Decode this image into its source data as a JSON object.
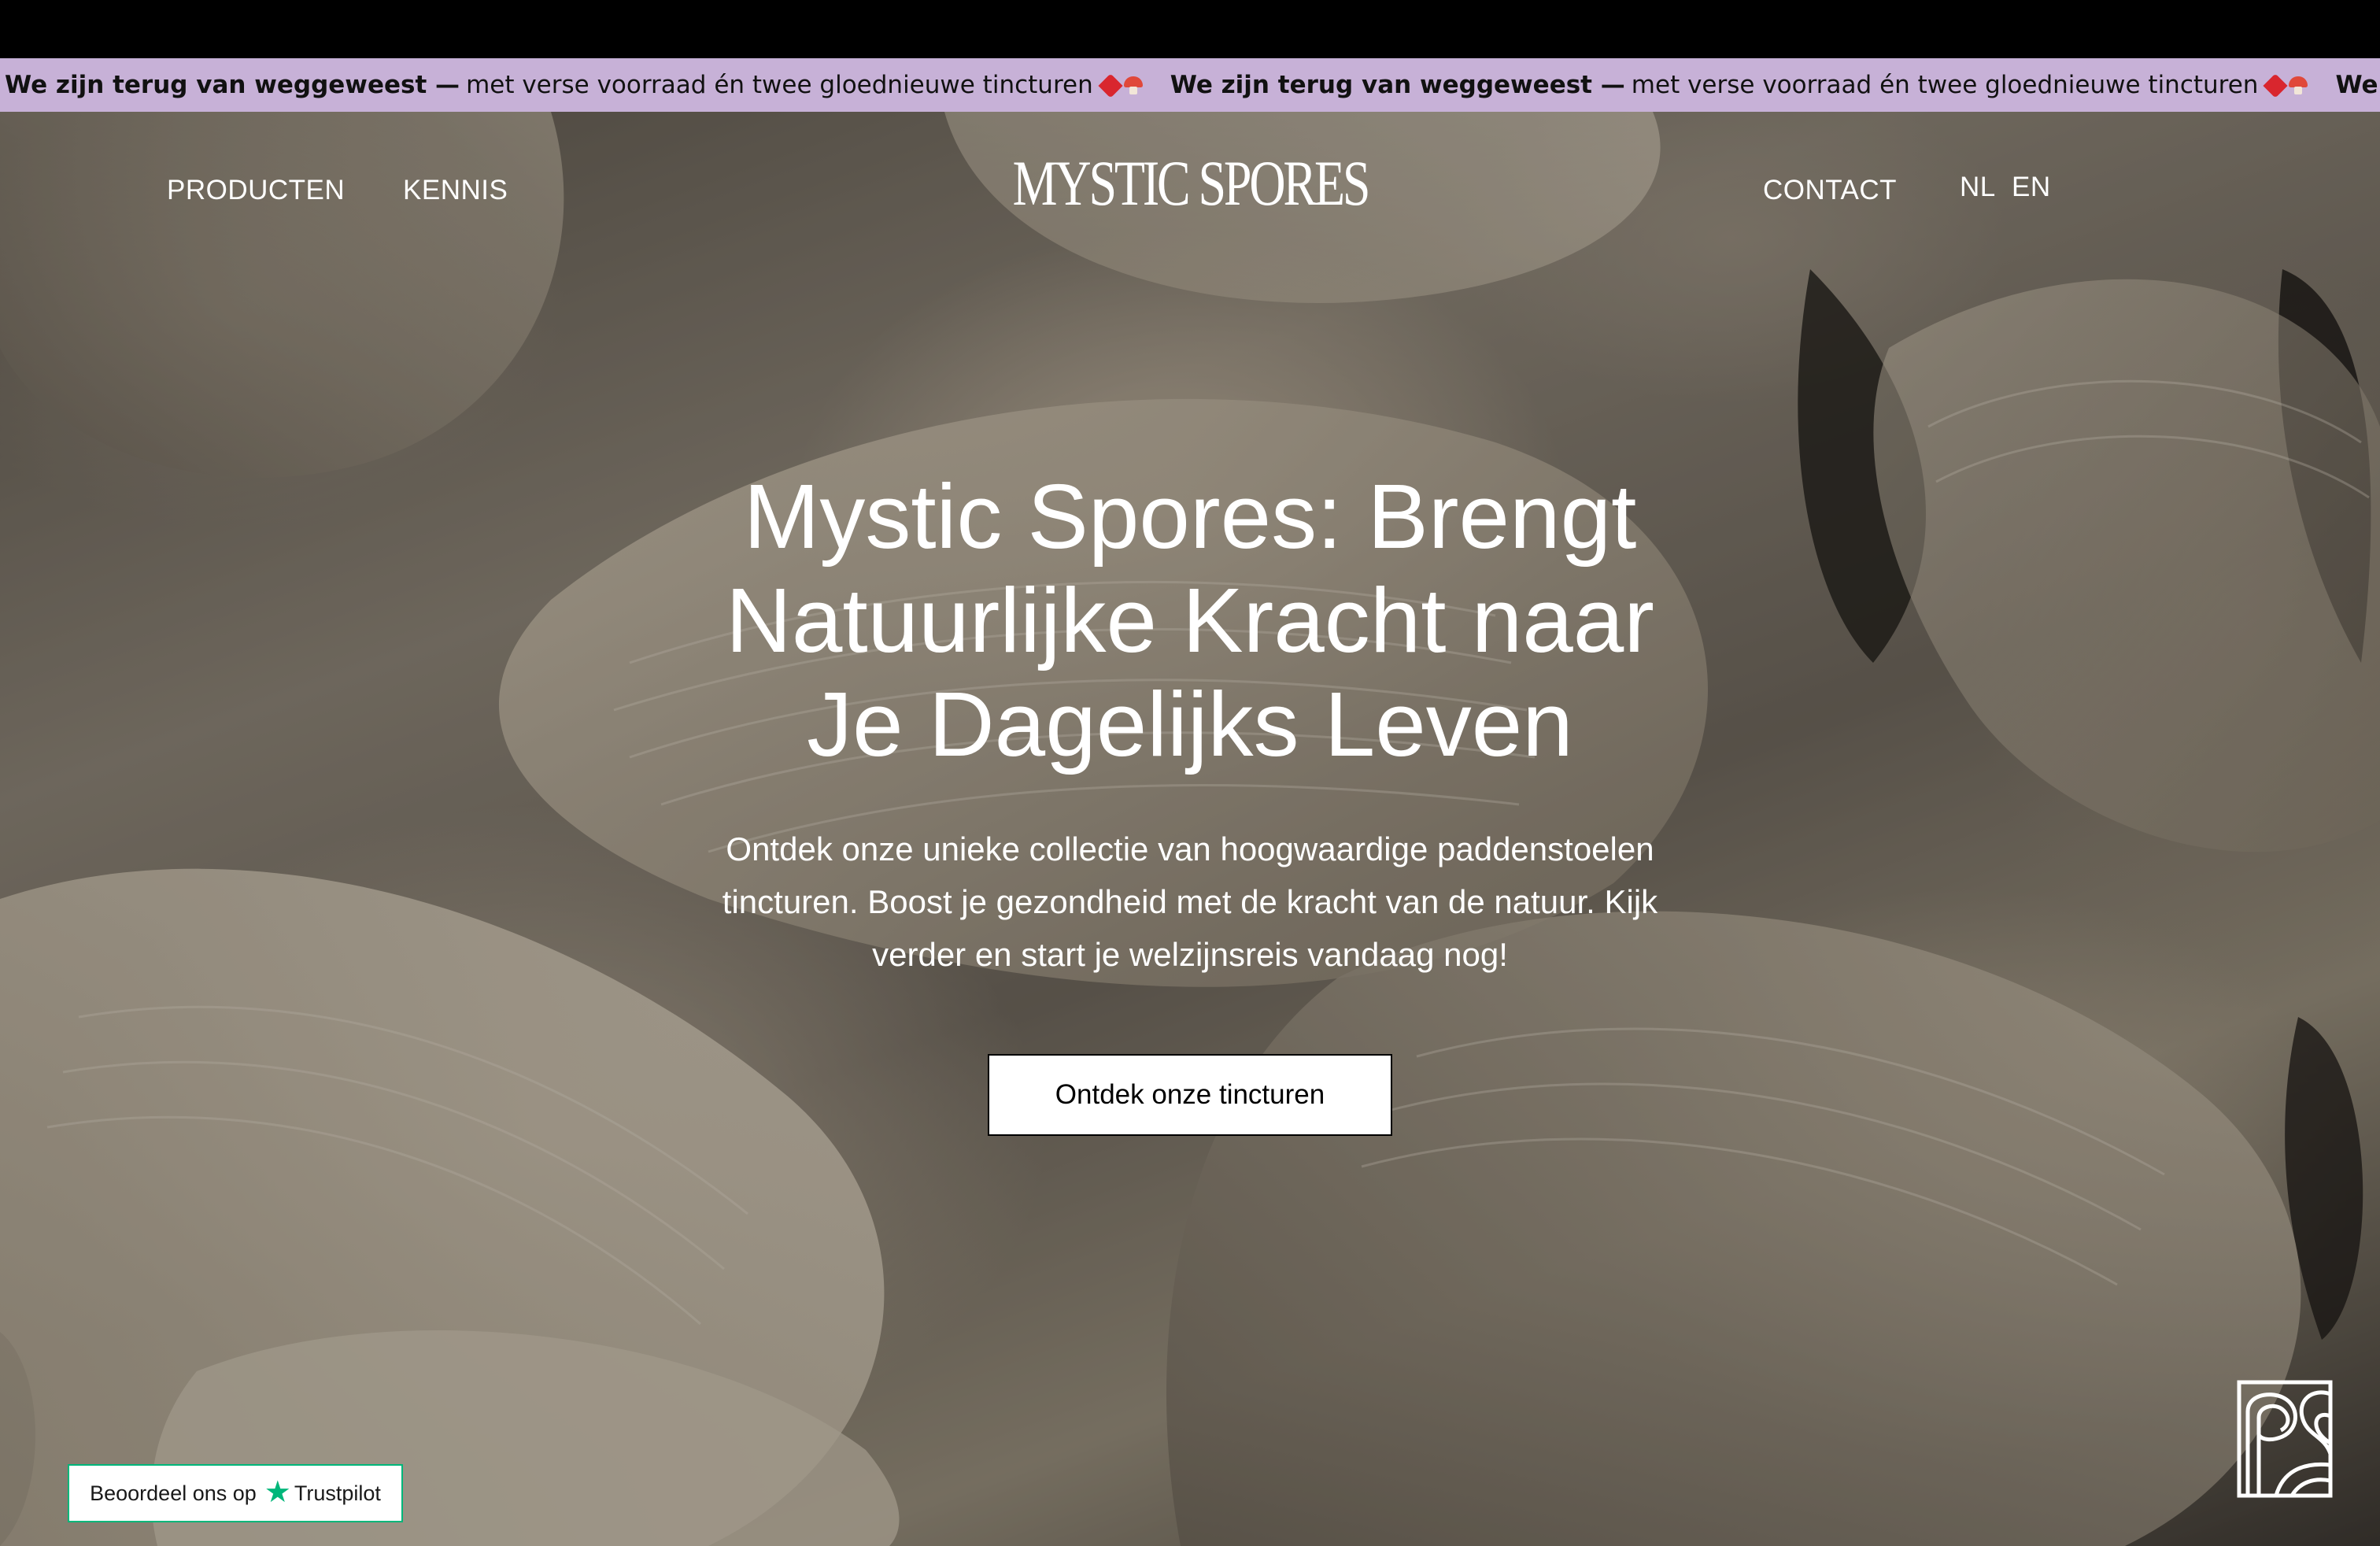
{
  "announcement": {
    "items": [
      {
        "bold": "We zijn terug van weggeweest —",
        "text": "met verse voorraad én twee gloednieuwe tincturen"
      },
      {
        "bold": "We zijn terug van weggeweest —",
        "text": "met verse voorraad én twee gloednieuwe tincturen"
      },
      {
        "bold": "We zijn terug van weggeweest",
        "text": ""
      }
    ],
    "emoji": [
      "heart-icon",
      "mushroom-icon"
    ],
    "background": "#c7b1d7"
  },
  "nav": {
    "left": [
      "PRODUCTEN",
      "KENNIS"
    ],
    "logo": "MYSTIC SPORES",
    "contact": "CONTACT",
    "languages": [
      "NL",
      "EN"
    ]
  },
  "hero": {
    "title_lines": [
      "Mystic Spores: Brengt",
      "Natuurlijke Kracht naar",
      "Je Dagelijks Leven"
    ],
    "subtitle_lines": [
      "Ontdek onze unieke collectie van hoogwaardige paddenstoelen",
      "tincturen. Boost je gezondheid met de kracht van de natuur. Kijk",
      "verder en start je welzijnsreis vandaag nog!"
    ],
    "cta": "Ontdek onze tincturen"
  },
  "trustpilot": {
    "label": "Beoordeel ons op",
    "brand": "Trustpilot",
    "color": "#00b67a"
  },
  "corner_widget": {
    "icon": "brand-mark-icon"
  }
}
